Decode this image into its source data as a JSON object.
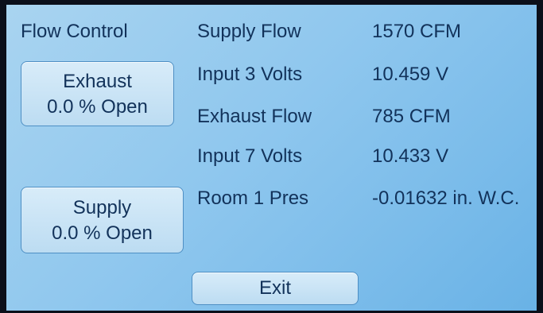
{
  "screen": {
    "title": "Flow Control"
  },
  "buttons": {
    "exhaust": {
      "label": "Exhaust",
      "status": "0.0 % Open"
    },
    "supply": {
      "label": "Supply",
      "status": "0.0 % Open"
    },
    "exit": {
      "label": "Exit"
    }
  },
  "readings": [
    {
      "name": "Supply Flow",
      "value": "1570 CFM"
    },
    {
      "name": "Input 3 Volts",
      "value": "10.459 V"
    },
    {
      "name": "Exhaust Flow",
      "value": "785 CFM"
    },
    {
      "name": "Input 7 Volts",
      "value": "10.433 V"
    },
    {
      "name": "Room 1 Pres",
      "value": "-0.01632 in. W.C."
    }
  ]
}
